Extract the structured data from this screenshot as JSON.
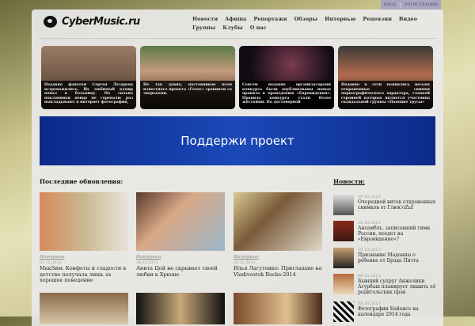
{
  "topbar": {
    "login": "ВХОД",
    "register": "РЕГИСТРАЦИЯ"
  },
  "logo": "CyberMusic.ru",
  "nav": [
    "Новости",
    "Афиша",
    "Репортажи",
    "Обзоры",
    "Интервью",
    "Рецензии",
    "Видео",
    "Группы",
    "Клубы",
    "О нас"
  ],
  "slider": [
    {
      "text": "Недавно фанатки Сергея Лазарева встревожились. Их любимый кумир попал в больницу. Но сильно поклонники певца не горевали: раз выкладывают в интернет фотографии,"
    },
    {
      "text": "Не так давно, наставников всем известного проекта «Голос» сравнили со зверьками."
    },
    {
      "text": "Совсем недавно организаторами конкурса были опубликованы новые правила к проведению «Евровидения». Правила конкурса стали более жёсткими. По достоверной"
    },
    {
      "text": "Недавно в сети появились весьма откровенные снимки порнографического характера, главной героиней которых является участница скандальной группы «Пающие трусы»"
    }
  ],
  "banner": "Поддержи проект",
  "latest": {
    "heading": "Последние обновления:",
    "items": [
      {
        "category": "Интервью",
        "date": "25.12.2013",
        "title": "МакSим: Конфеты и сладости в детстве получала лишь за хорошее поведение"
      },
      {
        "category": "Интервью",
        "date": "24.12.2013",
        "title": "Анита Цой не скрывает своей любви к Хрюше"
      },
      {
        "category": "Интервью",
        "date": "23.12.2013",
        "title": "Илья Лагутенко: Приглашаю на Vladivostok Rocks-2014"
      }
    ]
  },
  "news": {
    "heading": "Новости:",
    "items": [
      {
        "date": "10.10.2013",
        "title": "Очередной виток откровенных снимков от Глюк'oZы!"
      },
      {
        "date": "10.10.2013",
        "title": "Ансамбль, записавший гимн России, поедет на «Евровидение»?"
      },
      {
        "date": "09.10.2013",
        "title": "Признание Мадонны о ребенке от Брэда Питта"
      },
      {
        "date": "09.10.2013",
        "title": "Бывший супруг Анжелики Агурбаш планирует лишить её родительских прав"
      },
      {
        "date": "08.10.2013",
        "title": "Фотографии Бейонсе на календаре 2014 года"
      }
    ]
  }
}
